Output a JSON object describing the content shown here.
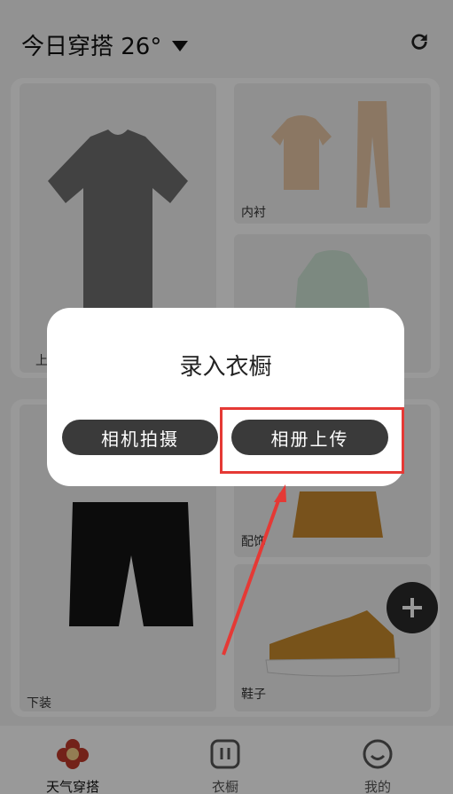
{
  "header": {
    "title": "今日穿搭 26°",
    "refresh_icon": "refresh-icon"
  },
  "tiles": {
    "tops": "上装",
    "underwear": "内衬",
    "outerwear": "",
    "bottoms": "下装",
    "accessories": "配饰",
    "shoes": "鞋子"
  },
  "fab": {
    "icon": "plus-icon"
  },
  "tabs": [
    {
      "label": "天气穿搭",
      "icon": "weather-outfit-icon",
      "active": true
    },
    {
      "label": "衣橱",
      "icon": "wardrobe-icon",
      "active": false
    },
    {
      "label": "我的",
      "icon": "profile-icon",
      "active": false
    }
  ],
  "dialog": {
    "title": "录入衣橱",
    "camera_label": "相机拍摄",
    "album_label": "相册上传"
  },
  "colors": {
    "accent": "#e53935",
    "button": "#3a3a3a",
    "brand": "#c0392b"
  }
}
